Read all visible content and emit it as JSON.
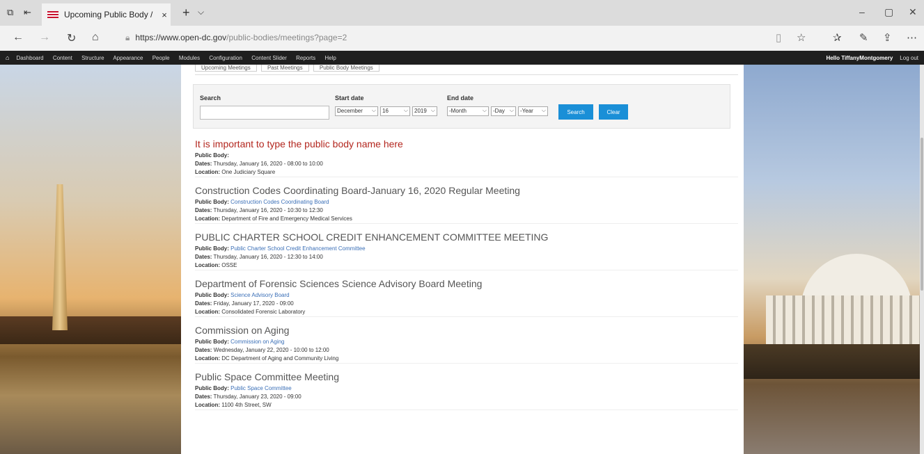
{
  "browser": {
    "tab_title": "Upcoming Public Body / ",
    "tab_close": "×",
    "new_tab": "+",
    "tab_menu": "⌵",
    "url_domain": "https://www.open-dc.gov",
    "url_path": "/public-bodies/meetings?page=2",
    "window_min": "–",
    "window_max": "▢",
    "window_close": "✕"
  },
  "admin_toolbar": {
    "home": "⌂",
    "menu": [
      "Dashboard",
      "Content",
      "Structure",
      "Appearance",
      "People",
      "Modules",
      "Configuration",
      "Content Slider",
      "Reports",
      "Help"
    ],
    "greeting": "Hello TiffanyMontgomery",
    "logout": "Log out"
  },
  "subtabs": [
    "Upcoming Meetings",
    "Past Meetings",
    "Public Body Meetings"
  ],
  "filter": {
    "search_label": "Search",
    "search_value": "",
    "start_label": "Start date",
    "start_month": "December",
    "start_day": "16",
    "start_year": "2019",
    "end_label": "End date",
    "end_month": "-Month",
    "end_day": "-Day",
    "end_year": "-Year",
    "search_button": "Search",
    "clear_button": "Clear"
  },
  "labels": {
    "public_body": "Public Body:",
    "dates": "Dates:",
    "location": "Location:"
  },
  "meetings": [
    {
      "title": "It is important to type the public body name here",
      "public_body": "",
      "dates": "Thursday, January 16, 2020 - 08:00 to 10:00",
      "location": "One Judiciary Square"
    },
    {
      "title": "Construction Codes Coordinating Board-January 16, 2020 Regular Meeting",
      "public_body": "Construction Codes Coordinating Board",
      "dates": "Thursday, January 16, 2020 - 10:30 to 12:30",
      "location": "Department of Fire and Emergency Medical Services"
    },
    {
      "title": "PUBLIC CHARTER SCHOOL CREDIT ENHANCEMENT COMMITTEE MEETING",
      "public_body": "Public Charter School Credit Enhancement Committee",
      "dates": "Thursday, January 16, 2020 - 12:30 to 14:00",
      "location": "OSSE"
    },
    {
      "title": "Department of Forensic Sciences Science Advisory Board Meeting",
      "public_body": "Science Advisory Board",
      "dates": "Friday, January 17, 2020 - 09:00",
      "location": "Consolidated Forensic Laboratory"
    },
    {
      "title": "Commission on Aging",
      "public_body": "Commission on Aging",
      "dates": "Wednesday, January 22, 2020 - 10:00 to 12:00",
      "location": "DC Department of Aging and Community Living"
    },
    {
      "title": "Public Space Committee Meeting",
      "public_body": "Public Space Committee",
      "dates": "Thursday, January 23, 2020 - 09:00",
      "location": "1100 4th Street, SW"
    }
  ]
}
